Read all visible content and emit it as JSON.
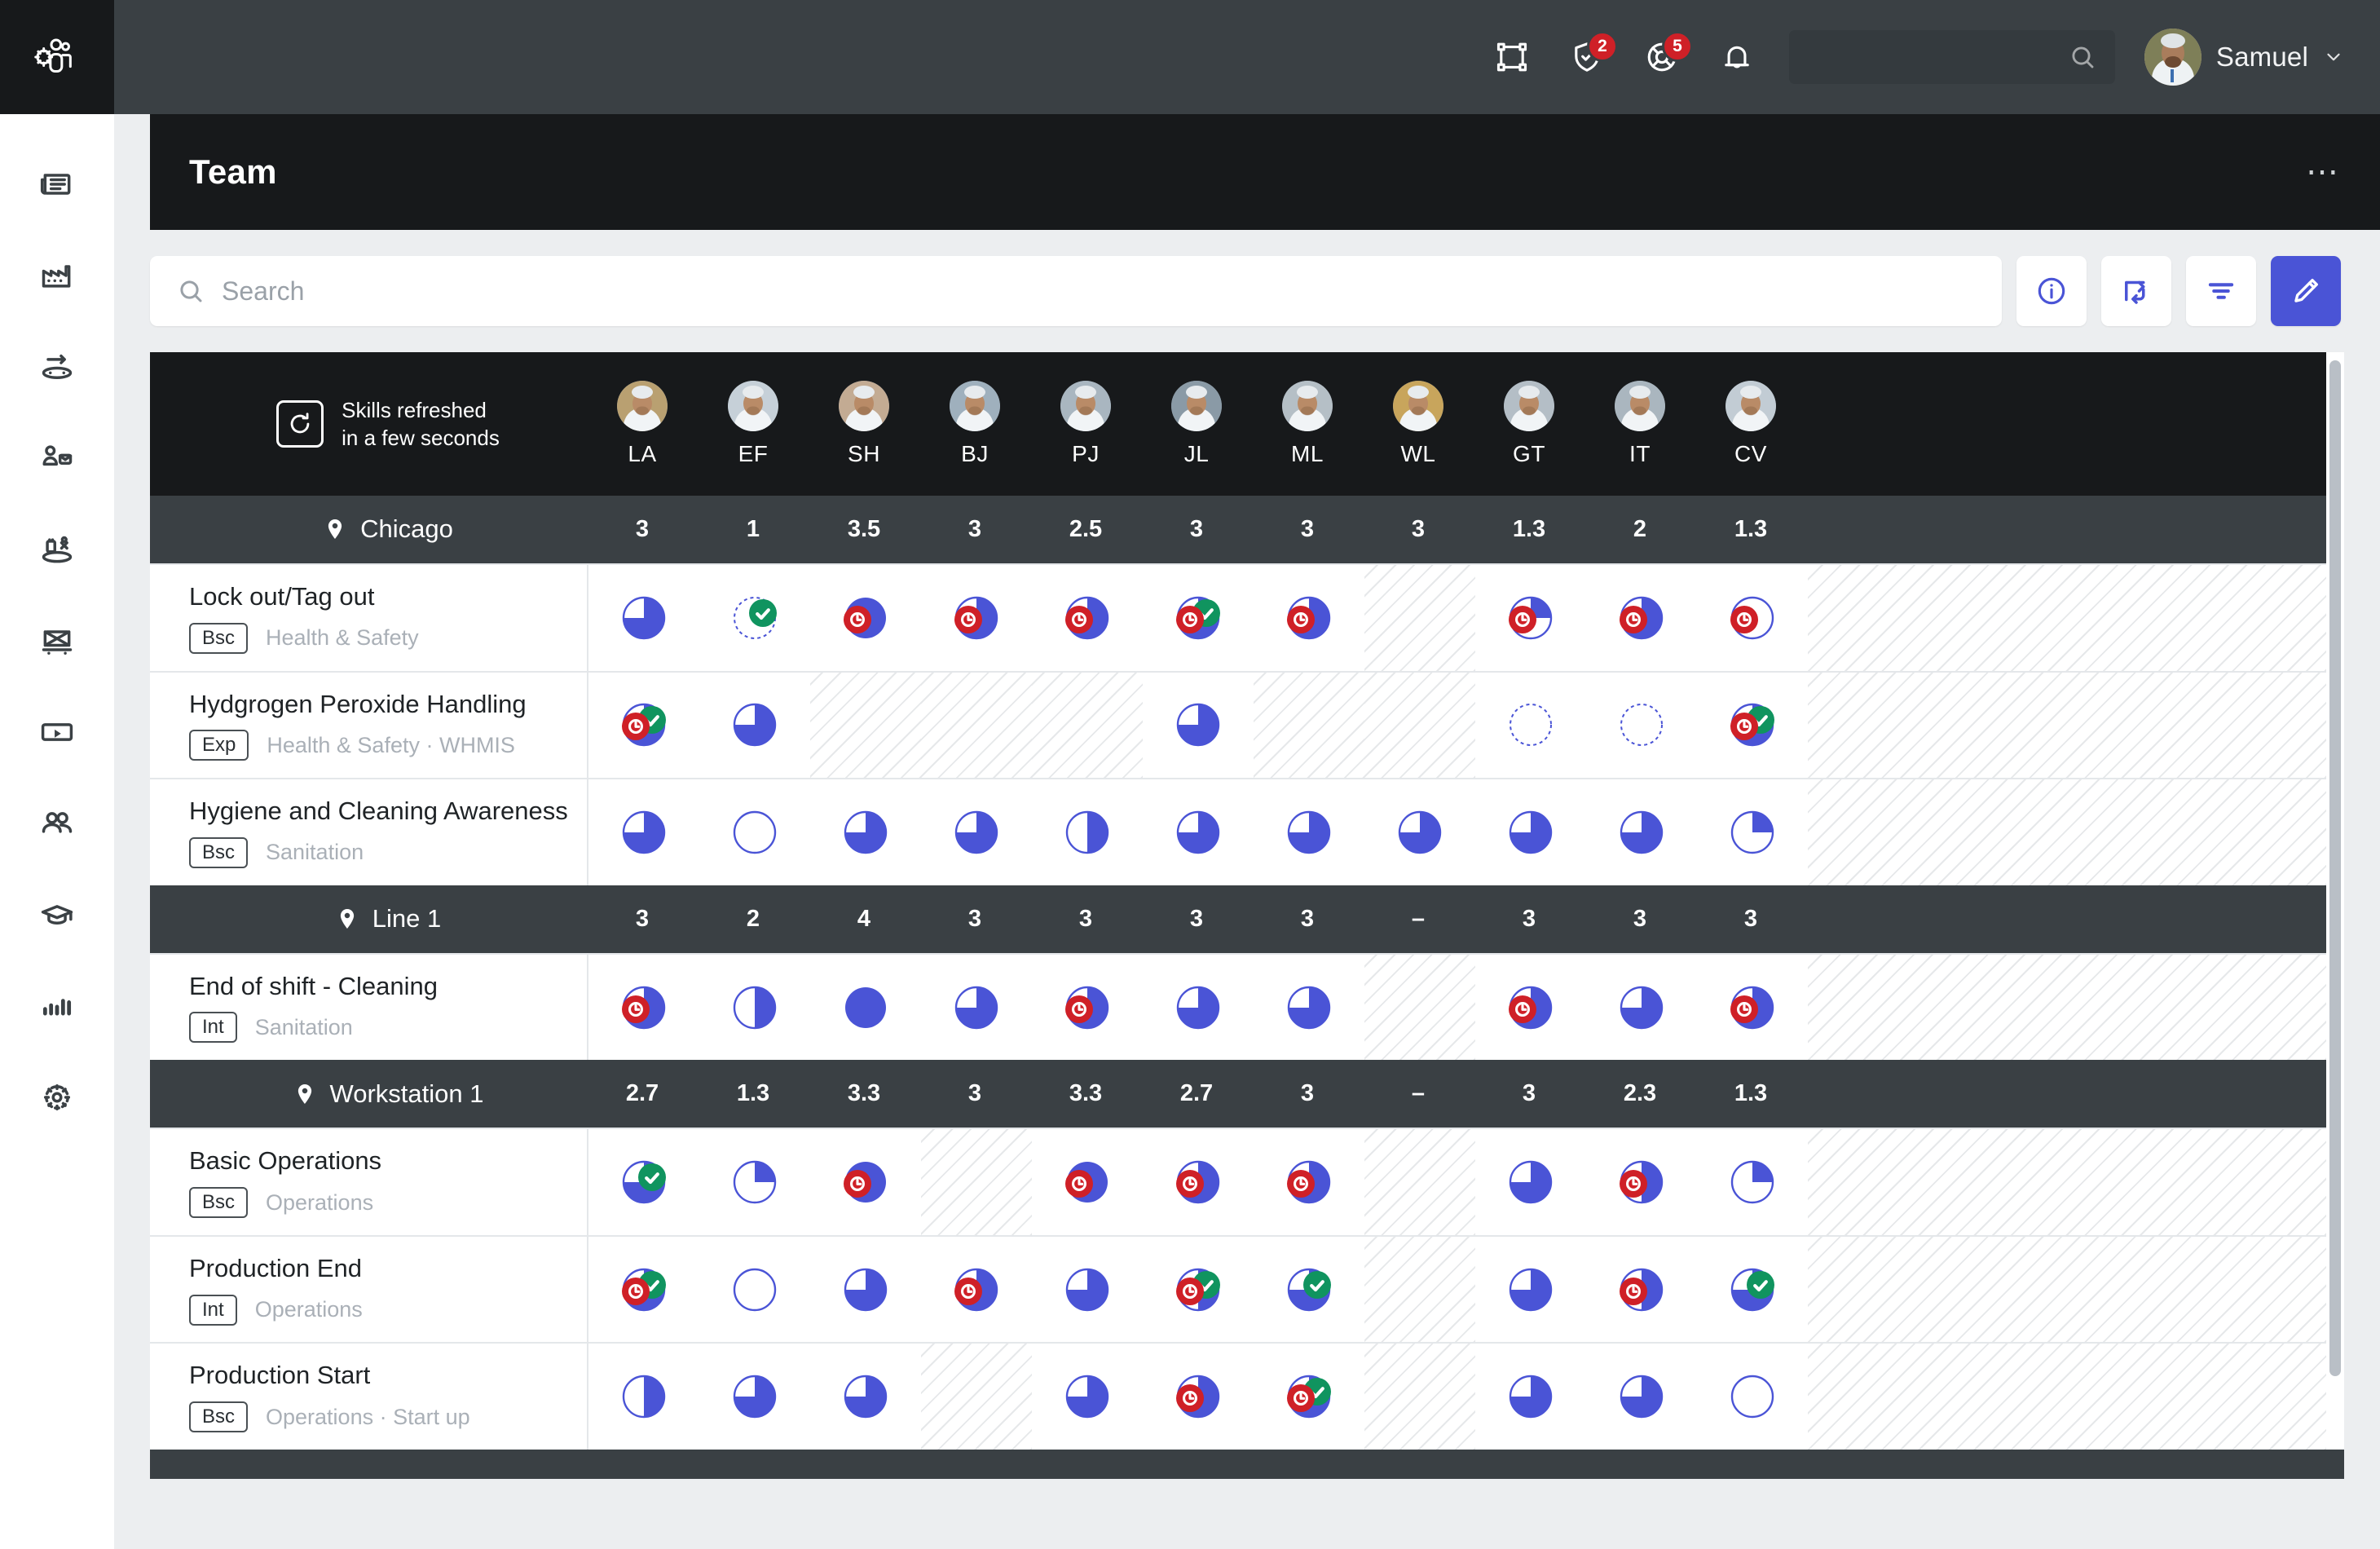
{
  "brand": {
    "logo_icon": "team-gear-icon",
    "accent": "#4a54d6",
    "dark": "#17191b"
  },
  "topbar": {
    "icons": [
      {
        "name": "layout-frame-icon",
        "badge": null
      },
      {
        "name": "shield-check-icon",
        "badge": "2"
      },
      {
        "name": "lifebuoy-icon",
        "badge": "5"
      },
      {
        "name": "bell-icon",
        "badge": null
      }
    ],
    "search_placeholder": "",
    "search_value": "",
    "user_name": "Samuel"
  },
  "sidebar": {
    "items": [
      {
        "icon": "news-article-icon",
        "label": "News"
      },
      {
        "icon": "factory-icon",
        "label": "Plants"
      },
      {
        "icon": "process-flow-icon",
        "label": "Process"
      },
      {
        "icon": "person-task-icon",
        "label": "Assignments"
      },
      {
        "icon": "machine-line-icon",
        "label": "Equipment"
      },
      {
        "icon": "package-icon",
        "label": "Products"
      },
      {
        "icon": "video-player-icon",
        "label": "Training videos"
      },
      {
        "icon": "people-team-icon",
        "label": "Team"
      },
      {
        "icon": "graduation-cap-icon",
        "label": "Learning"
      },
      {
        "icon": "bar-chart-icon",
        "label": "Analytics"
      },
      {
        "icon": "gear-icon",
        "label": "Settings"
      }
    ]
  },
  "page": {
    "title": "Team",
    "overflow_label": "⋯"
  },
  "toolbar": {
    "search_placeholder": "Search",
    "search_value": "",
    "buttons": [
      {
        "name": "info-button",
        "icon": "info-circle-icon"
      },
      {
        "name": "transpose-button",
        "icon": "transpose-arrows-icon"
      },
      {
        "name": "filter-button",
        "icon": "filter-icon"
      },
      {
        "name": "edit-button",
        "icon": "pencil-icon",
        "primary": true
      }
    ]
  },
  "matrix": {
    "refresh": {
      "icon": "refresh-icon",
      "line1": "Skills refreshed",
      "line2": "in a few seconds"
    },
    "members": [
      {
        "initials": "LA",
        "avatar_tint": "#b9a071"
      },
      {
        "initials": "EF",
        "avatar_tint": "#c6d0d8"
      },
      {
        "initials": "SH",
        "avatar_tint": "#c3ab93"
      },
      {
        "initials": "BJ",
        "avatar_tint": "#9fb0bd"
      },
      {
        "initials": "PJ",
        "avatar_tint": "#a9b6c0"
      },
      {
        "initials": "JL",
        "avatar_tint": "#8a9aa6"
      },
      {
        "initials": "ML",
        "avatar_tint": "#b5bfc6"
      },
      {
        "initials": "WL",
        "avatar_tint": "#c8a55c"
      },
      {
        "initials": "GT",
        "avatar_tint": "#b4bec6"
      },
      {
        "initials": "IT",
        "avatar_tint": "#aab6bf"
      },
      {
        "initials": "CV",
        "avatar_tint": "#c2ccd4"
      }
    ],
    "groups": [
      {
        "location": "Chicago",
        "values": [
          "3",
          "1",
          "3.5",
          "3",
          "2.5",
          "3",
          "3",
          "3",
          "1.3",
          "2",
          "1.3"
        ],
        "skills": [
          {
            "name": "Lock out/Tag out",
            "level": "Bsc",
            "category": "Health & Safety",
            "cells": [
              {
                "fill": 0.75
              },
              {
                "fill": 0,
                "dashed": true,
                "check": true
              },
              {
                "fill": 1,
                "clock": true
              },
              {
                "fill": 0.75,
                "clock": true
              },
              {
                "fill": 0.75,
                "clock": true
              },
              {
                "fill": 0.75,
                "clock": true,
                "check": true
              },
              {
                "fill": 0.75,
                "clock": true
              },
              {
                "na": true
              },
              {
                "fill": 0.25,
                "clock": true
              },
              {
                "fill": 0.75,
                "clock": true
              },
              {
                "fill": 0,
                "clock": true
              }
            ]
          },
          {
            "name": "Hydgrogen Peroxide Handling",
            "level": "Exp",
            "category": "Health & Safety · WHMIS",
            "cells": [
              {
                "fill": 0.75,
                "clock": true,
                "check": true
              },
              {
                "fill": 0.75
              },
              {
                "na": true
              },
              {
                "na": true
              },
              {
                "na": true
              },
              {
                "fill": 0.75
              },
              {
                "na": true
              },
              {
                "na": true
              },
              {
                "fill": 0,
                "dashed": true
              },
              {
                "fill": 0,
                "dashed": true
              },
              {
                "fill": 0.75,
                "clock": true,
                "check": true
              }
            ]
          },
          {
            "name": "Hygiene and Cleaning Awareness",
            "level": "Bsc",
            "category": "Sanitation",
            "cells": [
              {
                "fill": 0.75
              },
              {
                "fill": 0
              },
              {
                "fill": 0.75
              },
              {
                "fill": 0.75
              },
              {
                "fill": 0.5
              },
              {
                "fill": 0.75
              },
              {
                "fill": 0.75
              },
              {
                "fill": 0.75
              },
              {
                "fill": 0.75
              },
              {
                "fill": 0.75
              },
              {
                "fill": 0.25
              }
            ]
          }
        ]
      },
      {
        "location": "Line 1",
        "values": [
          "3",
          "2",
          "4",
          "3",
          "3",
          "3",
          "3",
          "–",
          "3",
          "3",
          "3"
        ],
        "skills": [
          {
            "name": "End of shift - Cleaning",
            "level": "Int",
            "category": "Sanitation",
            "cells": [
              {
                "fill": 0.75,
                "clock": true
              },
              {
                "fill": 0.5
              },
              {
                "fill": 1
              },
              {
                "fill": 0.75
              },
              {
                "fill": 0.75,
                "clock": true
              },
              {
                "fill": 0.75
              },
              {
                "fill": 0.75
              },
              {
                "na": true
              },
              {
                "fill": 0.75,
                "clock": true
              },
              {
                "fill": 0.75
              },
              {
                "fill": 0.75,
                "clock": true
              }
            ]
          }
        ]
      },
      {
        "location": "Workstation 1",
        "values": [
          "2.7",
          "1.3",
          "3.3",
          "3",
          "3.3",
          "2.7",
          "3",
          "–",
          "3",
          "2.3",
          "1.3"
        ],
        "skills": [
          {
            "name": "Basic Operations",
            "level": "Bsc",
            "category": "Operations",
            "cells": [
              {
                "fill": 0.75,
                "check": true
              },
              {
                "fill": 0.25
              },
              {
                "fill": 1,
                "clock": true
              },
              {
                "na": true
              },
              {
                "fill": 1,
                "clock": true
              },
              {
                "fill": 0.75,
                "clock": true
              },
              {
                "fill": 0.75,
                "clock": true
              },
              {
                "na": true
              },
              {
                "fill": 0.75
              },
              {
                "fill": 0.5,
                "clock": true
              },
              {
                "fill": 0.25
              }
            ]
          },
          {
            "name": "Production End",
            "level": "Int",
            "category": "Operations",
            "cells": [
              {
                "fill": 0.75,
                "clock": true,
                "check": true
              },
              {
                "fill": 0
              },
              {
                "fill": 0.75
              },
              {
                "fill": 0.75,
                "clock": true
              },
              {
                "fill": 0.75
              },
              {
                "fill": 0.5,
                "clock": true,
                "check": true
              },
              {
                "fill": 0.75,
                "check": true
              },
              {
                "na": true
              },
              {
                "fill": 0.75
              },
              {
                "fill": 0.5,
                "clock": true
              },
              {
                "fill": 0.75,
                "check": true
              }
            ]
          },
          {
            "name": "Production Start",
            "level": "Bsc",
            "category": "Operations · Start up",
            "cells": [
              {
                "fill": 0.5
              },
              {
                "fill": 0.75
              },
              {
                "fill": 0.75
              },
              {
                "na": true
              },
              {
                "fill": 0.75
              },
              {
                "fill": 0.75,
                "clock": true
              },
              {
                "fill": 0.75,
                "clock": true,
                "check": true
              },
              {
                "na": true
              },
              {
                "fill": 0.75
              },
              {
                "fill": 0.75
              },
              {
                "fill": 0
              }
            ]
          }
        ]
      }
    ]
  }
}
